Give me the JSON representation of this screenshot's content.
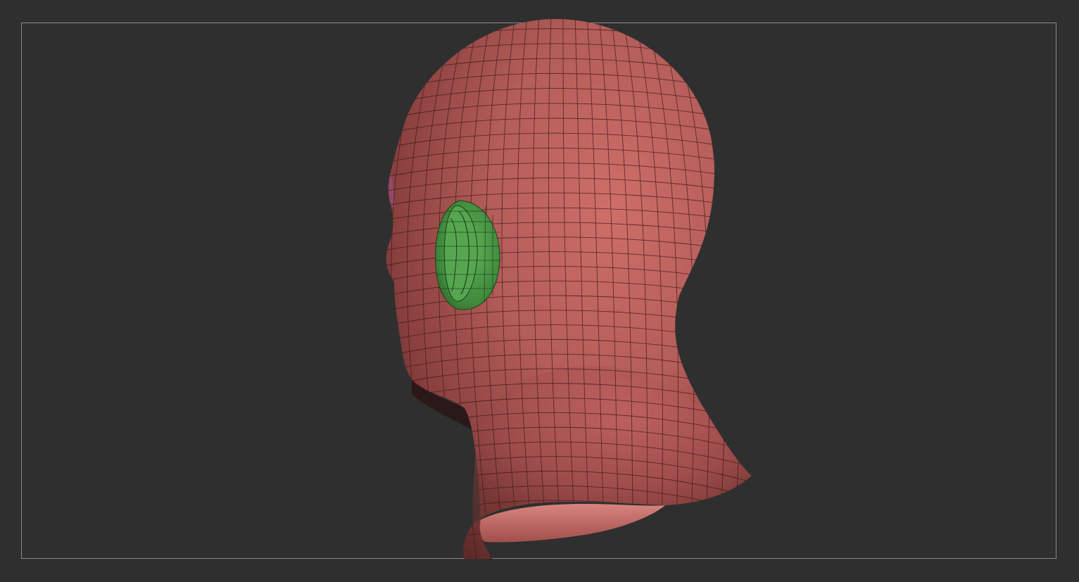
{
  "viewport": {
    "background_color": "#2f2f2f",
    "frame_color": "#8a8a8a"
  },
  "model": {
    "subject": "head-mesh",
    "polygroups": [
      {
        "name": "head",
        "color": "#b35a58"
      },
      {
        "name": "ear",
        "color": "#4f9a4a"
      }
    ],
    "wireframe_color": "#3a1818"
  }
}
